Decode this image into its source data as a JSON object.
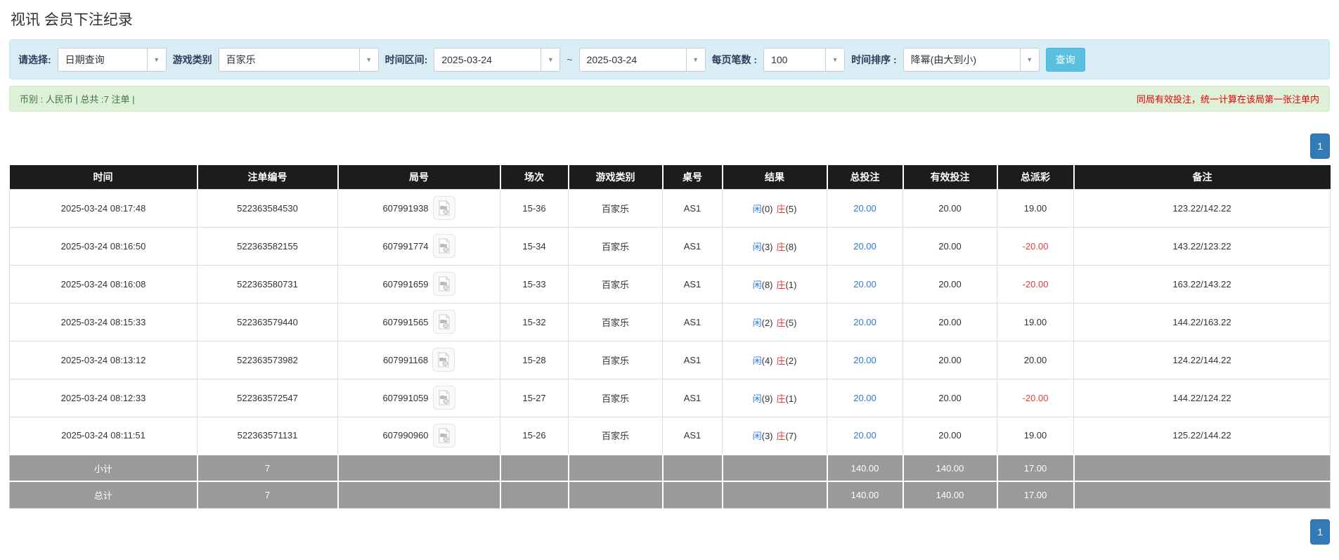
{
  "page": {
    "title": "视讯 会员下注纪录"
  },
  "filters": {
    "select_type_label": "请选择:",
    "select_type_value": "日期查询",
    "game_category_label": "游戏类别",
    "game_category_value": "百家乐",
    "time_range_label": "时间区间:",
    "date_from": "2025-03-24",
    "tilde": "~",
    "date_to": "2025-03-24",
    "page_size_label": "每页笔数 :",
    "page_size_value": "100",
    "sort_label": "时间排序 :",
    "sort_value": "降幂(由大到小)",
    "search_button_label": "查询"
  },
  "summary": {
    "left_text": "币别 : 人民币 | 总共 :7 注单 |",
    "right_note": "同局有效投注，统一计算在该局第一张注单内"
  },
  "pagination": {
    "current_page": "1"
  },
  "table": {
    "headers": [
      "时间",
      "注单编号",
      "局号",
      "场次",
      "游戏类别",
      "桌号",
      "结果",
      "总投注",
      "有效投注",
      "总派彩",
      "备注"
    ],
    "rows": [
      {
        "time": "2025-03-24 08:17:48",
        "bet_id": "522363584530",
        "round_id": "607991938",
        "session": "15-36",
        "game": "百家乐",
        "table_no": "AS1",
        "player_label": "闲",
        "player_score": "(0)",
        "banker_label": "庄",
        "banker_score": "(5)",
        "total_bet": "20.00",
        "valid_bet": "20.00",
        "payout": "19.00",
        "remark": "123.22/142.22"
      },
      {
        "time": "2025-03-24 08:16:50",
        "bet_id": "522363582155",
        "round_id": "607991774",
        "session": "15-34",
        "game": "百家乐",
        "table_no": "AS1",
        "player_label": "闲",
        "player_score": "(3)",
        "banker_label": "庄",
        "banker_score": "(8)",
        "total_bet": "20.00",
        "valid_bet": "20.00",
        "payout": "-20.00",
        "remark": "143.22/123.22"
      },
      {
        "time": "2025-03-24 08:16:08",
        "bet_id": "522363580731",
        "round_id": "607991659",
        "session": "15-33",
        "game": "百家乐",
        "table_no": "AS1",
        "player_label": "闲",
        "player_score": "(8)",
        "banker_label": "庄",
        "banker_score": "(1)",
        "total_bet": "20.00",
        "valid_bet": "20.00",
        "payout": "-20.00",
        "remark": "163.22/143.22"
      },
      {
        "time": "2025-03-24 08:15:33",
        "bet_id": "522363579440",
        "round_id": "607991565",
        "session": "15-32",
        "game": "百家乐",
        "table_no": "AS1",
        "player_label": "闲",
        "player_score": "(2)",
        "banker_label": "庄",
        "banker_score": "(5)",
        "total_bet": "20.00",
        "valid_bet": "20.00",
        "payout": "19.00",
        "remark": "144.22/163.22"
      },
      {
        "time": "2025-03-24 08:13:12",
        "bet_id": "522363573982",
        "round_id": "607991168",
        "session": "15-28",
        "game": "百家乐",
        "table_no": "AS1",
        "player_label": "闲",
        "player_score": "(4)",
        "banker_label": "庄",
        "banker_score": "(2)",
        "total_bet": "20.00",
        "valid_bet": "20.00",
        "payout": "20.00",
        "remark": "124.22/144.22"
      },
      {
        "time": "2025-03-24 08:12:33",
        "bet_id": "522363572547",
        "round_id": "607991059",
        "session": "15-27",
        "game": "百家乐",
        "table_no": "AS1",
        "player_label": "闲",
        "player_score": "(9)",
        "banker_label": "庄",
        "banker_score": "(1)",
        "total_bet": "20.00",
        "valid_bet": "20.00",
        "payout": "-20.00",
        "remark": "144.22/124.22"
      },
      {
        "time": "2025-03-24 08:11:51",
        "bet_id": "522363571131",
        "round_id": "607990960",
        "session": "15-26",
        "game": "百家乐",
        "table_no": "AS1",
        "player_label": "闲",
        "player_score": "(3)",
        "banker_label": "庄",
        "banker_score": "(7)",
        "total_bet": "20.00",
        "valid_bet": "20.00",
        "payout": "19.00",
        "remark": "125.22/144.22"
      }
    ],
    "subtotal": {
      "label": "小计",
      "count": "7",
      "total_bet": "140.00",
      "valid_bet": "140.00",
      "payout": "17.00"
    },
    "grand_total": {
      "label": "总计",
      "count": "7",
      "total_bet": "140.00",
      "valid_bet": "140.00",
      "payout": "17.00"
    }
  },
  "icons": {
    "select_arrow": "▼",
    "video_replay": "video-file-icon"
  },
  "colors": {
    "filter_bar_bg": "#d9edf7",
    "search_button_bg": "#5bc0de",
    "summary_bar_bg": "#dff0d8",
    "summary_text_green": "#3c763d",
    "note_red": "#e60000",
    "table_header_bg": "#1c1c1c",
    "footer_row_bg": "#9a9a9a",
    "pagination_active_bg": "#337ab7",
    "link_blue": "#2a7cdb",
    "player_blue": "#2a7cdb",
    "banker_red": "#e53c3c",
    "negative_red": "#e53c3c"
  }
}
